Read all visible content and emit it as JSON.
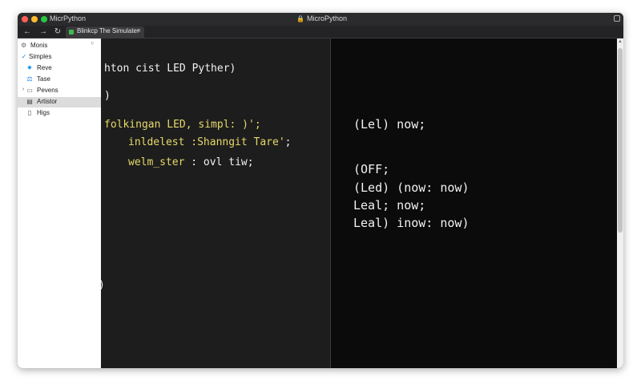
{
  "window": {
    "app_title": "MicrPython",
    "title": "MicroPython"
  },
  "tab": {
    "label": "Blinkcp The Simulater",
    "close": "×"
  },
  "nav": {
    "back": "←",
    "forward": "→",
    "reload": "↻"
  },
  "sidebar": {
    "header": "Monis",
    "collapse": "ᵇ",
    "items": [
      {
        "label": "Simples",
        "icon": "check-icon",
        "glyph": "✓"
      },
      {
        "label": "Reve",
        "icon": "bird-icon",
        "glyph": "🐦"
      },
      {
        "label": "Tase",
        "icon": "scale-icon",
        "glyph": "⚖"
      },
      {
        "label": "Pevens",
        "icon": "folder-icon",
        "glyph": "▭"
      },
      {
        "label": "Artistor",
        "icon": "table-icon",
        "glyph": "▤"
      },
      {
        "label": "Higs",
        "icon": "document-icon",
        "glyph": "▯"
      }
    ]
  },
  "editor": {
    "lines": [
      "hton cist LED Pyther)",
      ")",
      "folkingan LED, simpl: )';",
      "inldelest :Shanngit Tare'",
      ";",
      "welm_ster",
      " : ovl tiw;",
      ")"
    ]
  },
  "output": {
    "lines": [
      "(Lel) now;",
      "(OFF;",
      "(Led) (now: now)",
      "Leal; now;",
      "Leal) inow: now)"
    ]
  },
  "colors": {
    "code_text": "#f2f2f2",
    "code_keyword": "#e6d96a",
    "editor_bg": "#1d1d1d",
    "output_bg": "#0b0b0b",
    "sidebar_check": "#1e88e5"
  }
}
